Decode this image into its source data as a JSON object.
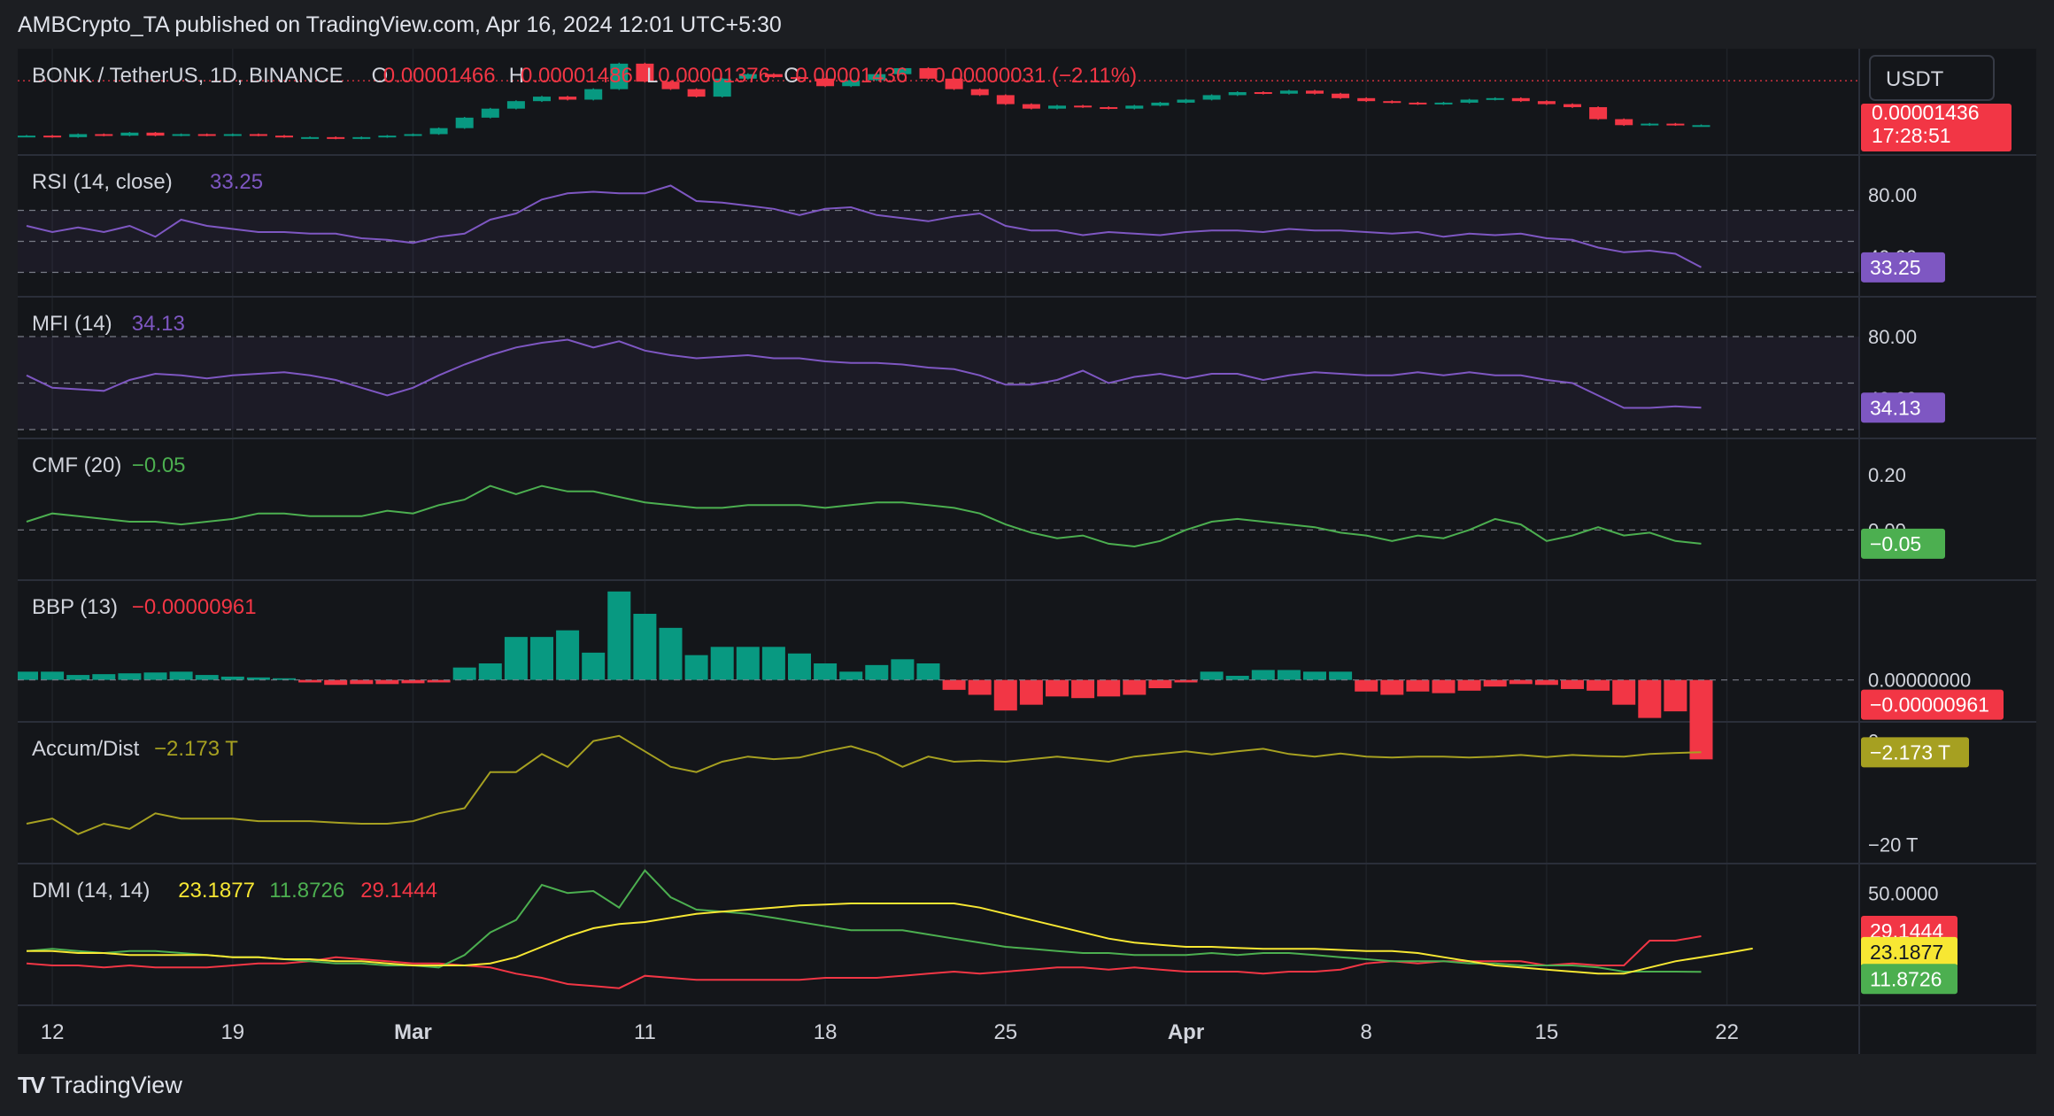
{
  "publisher": "AMBCrypto_TA published on TradingView.com, Apr 16, 2024 12:01 UTC+5:30",
  "footer": {
    "brand": "TradingView"
  },
  "currency_button": "USDT",
  "colors": {
    "up": "#089981",
    "down": "#f23645",
    "purple": "#7e57c2",
    "green": "#4caf50",
    "yellow": "#f7e733",
    "olive": "#a6a021",
    "text": "#d1d4dc"
  },
  "main": {
    "symbol": "BONK / TetherUS, 1D, BINANCE",
    "o_label": "O",
    "o": "0.00001466",
    "h_label": "H",
    "h": "0.00001486",
    "l_label": "L",
    "l": "0.00001376",
    "c_label": "C",
    "c": "0.00001436",
    "change": "−0.00000031 (−2.11%)",
    "price_badge": "0.00001436",
    "countdown": "17:28:51"
  },
  "rsi": {
    "label": "RSI (14, close)",
    "value": "33.25",
    "ticks": [
      "80.00",
      "40.00"
    ]
  },
  "mfi": {
    "label": "MFI (14)",
    "value": "34.13",
    "ticks": [
      "80.00",
      "40.00"
    ]
  },
  "cmf": {
    "label": "CMF (20)",
    "value": "−0.05",
    "ticks": [
      "0.20",
      "0.00"
    ]
  },
  "bbp": {
    "label": "BBP (13)",
    "value": "−0.00000961",
    "ticks": [
      "0.00000000"
    ]
  },
  "ad": {
    "label": "Accum/Dist",
    "value": "−2.173 T",
    "ticks": [
      "0",
      "−20 T"
    ]
  },
  "dmi": {
    "label": "DMI (14, 14)",
    "adx": "23.1877",
    "plus": "11.8726",
    "minus": "29.1444",
    "ticks": [
      "50.0000"
    ]
  },
  "x_axis": [
    "12",
    "19",
    "Mar",
    "11",
    "18",
    "25",
    "Apr",
    "8",
    "15",
    "22"
  ],
  "chart_data": [
    {
      "type": "candlestick",
      "title": "BONK / TetherUS, 1D, BINANCE",
      "x": "daily, 2024-02-11 to 2024-04-16",
      "close": [
        1.07e-05,
        1.06e-05,
        1.08e-05,
        1.07e-05,
        1.09e-05,
        1.07e-05,
        1.08e-05,
        1.07e-05,
        1.08e-05,
        1.07e-05,
        1.06e-05,
        1.06e-05,
        1.05e-05,
        1.06e-05,
        1.07e-05,
        1.08e-05,
        1.12e-05,
        1.19e-05,
        1.25e-05,
        1.3e-05,
        1.33e-05,
        1.31e-05,
        1.38e-05,
        1.55e-05,
        1.43e-05,
        1.38e-05,
        1.33e-05,
        1.45e-05,
        1.48e-05,
        1.46e-05,
        1.45e-05,
        1.4e-05,
        1.44e-05,
        1.48e-05,
        1.52e-05,
        1.45e-05,
        1.38e-05,
        1.34e-05,
        1.28e-05,
        1.25e-05,
        1.27e-05,
        1.26e-05,
        1.25e-05,
        1.27e-05,
        1.29e-05,
        1.31e-05,
        1.34e-05,
        1.36e-05,
        1.35e-05,
        1.37e-05,
        1.35e-05,
        1.32e-05,
        1.3e-05,
        1.29e-05,
        1.28e-05,
        1.29e-05,
        1.31e-05,
        1.32e-05,
        1.3e-05,
        1.28e-05,
        1.26e-05,
        1.18e-05,
        1.14e-05,
        1.15e-05,
        1.14e-05,
        1.14e-05
      ],
      "price_last": 1.436e-05
    },
    {
      "type": "line",
      "name": "RSI (14, close)",
      "ylim": [
        20,
        100
      ],
      "values": [
        60,
        56,
        59,
        56,
        60,
        53,
        64,
        60,
        58,
        56,
        56,
        55,
        55,
        52,
        51,
        49,
        53,
        55,
        64,
        68,
        77,
        81,
        82,
        81,
        81,
        86,
        76,
        75,
        73,
        71,
        67,
        71,
        72,
        67,
        65,
        63,
        66,
        68,
        60,
        57,
        57,
        54,
        56,
        55,
        54,
        56,
        57,
        57,
        56,
        58,
        57,
        57,
        56,
        55,
        56,
        53,
        55,
        54,
        55,
        52,
        51,
        46,
        43,
        44,
        42,
        33.25
      ],
      "hlines": [
        70,
        50,
        30
      ],
      "axis_ticks": [
        80,
        40
      ]
    },
    {
      "type": "line",
      "name": "MFI (14)",
      "ylim": [
        20,
        100
      ],
      "values": [
        55,
        47,
        46,
        45,
        52,
        56,
        55,
        53,
        55,
        56,
        57,
        55,
        52,
        47,
        42,
        47,
        55,
        62,
        68,
        73,
        76,
        78,
        73,
        77,
        71,
        68,
        66,
        67,
        68,
        66,
        66,
        64,
        63,
        63,
        62,
        60,
        59,
        55,
        49,
        49,
        52,
        58,
        50,
        54,
        56,
        53,
        56,
        56,
        52,
        55,
        57,
        56,
        55,
        55,
        57,
        55,
        57,
        55,
        55,
        52,
        50,
        42,
        34,
        34,
        35,
        34.13
      ],
      "hlines": [
        80,
        50,
        20
      ],
      "axis_ticks": [
        80,
        40
      ]
    },
    {
      "type": "line",
      "name": "CMF (20)",
      "ylim": [
        -0.15,
        0.3
      ],
      "values": [
        0.03,
        0.06,
        0.05,
        0.04,
        0.03,
        0.03,
        0.02,
        0.03,
        0.04,
        0.06,
        0.06,
        0.05,
        0.05,
        0.05,
        0.07,
        0.06,
        0.09,
        0.11,
        0.16,
        0.13,
        0.16,
        0.14,
        0.14,
        0.12,
        0.1,
        0.09,
        0.08,
        0.08,
        0.09,
        0.09,
        0.09,
        0.08,
        0.09,
        0.1,
        0.1,
        0.09,
        0.08,
        0.06,
        0.02,
        -0.01,
        -0.03,
        -0.02,
        -0.05,
        -0.06,
        -0.04,
        0.0,
        0.03,
        0.04,
        0.03,
        0.02,
        0.01,
        -0.01,
        -0.02,
        -0.04,
        -0.02,
        -0.03,
        0.0,
        0.04,
        0.02,
        -0.04,
        -0.02,
        0.01,
        -0.02,
        -0.01,
        -0.04,
        -0.05
      ],
      "hlines": [
        0
      ],
      "axis_ticks": [
        0.2,
        0.0
      ]
    },
    {
      "type": "bar",
      "name": "BBP (13)",
      "ylim": [
        -4e-06,
        1.1e-05
      ],
      "values": [
        1e-06,
        1e-06,
        6e-07,
        7e-07,
        8e-07,
        9e-07,
        1e-06,
        6e-07,
        4e-07,
        3e-07,
        2e-07,
        -3e-07,
        -6e-07,
        -5e-07,
        -5e-07,
        -4e-07,
        -3e-07,
        1.5e-06,
        2e-06,
        5.2e-06,
        5.2e-06,
        6e-06,
        3.3e-06,
        1.07e-05,
        8e-06,
        6.3e-06,
        3e-06,
        4e-06,
        4e-06,
        4e-06,
        3.2e-06,
        2e-06,
        1e-06,
        1.8e-06,
        2.5e-06,
        2e-06,
        -1.2e-06,
        -1.8e-06,
        -3.7e-06,
        -3e-06,
        -2e-06,
        -2.2e-06,
        -2e-06,
        -1.8e-06,
        -1e-06,
        -3e-07,
        1e-06,
        5e-07,
        1.2e-06,
        1.2e-06,
        1e-06,
        1e-06,
        -1.4e-06,
        -1.8e-06,
        -1.4e-06,
        -1.6e-06,
        -1.3e-06,
        -8e-07,
        -5e-07,
        -6e-07,
        -1.1e-06,
        -1.3e-06,
        -3e-06,
        -4.6e-06,
        -3.8e-06,
        -9.61e-06
      ]
    },
    {
      "type": "line",
      "name": "Accum/Dist",
      "ylim": [
        -22,
        2
      ],
      "values": [
        -16,
        -15,
        -18,
        -16,
        -17,
        -14,
        -15,
        -15,
        -15,
        -15.5,
        -15.5,
        -15.5,
        -15.8,
        -16,
        -16,
        -15.5,
        -14,
        -13,
        -6,
        -6,
        -2.5,
        -5,
        0,
        1,
        -2,
        -5,
        -6,
        -4,
        -3,
        -3.5,
        -3.2,
        -2,
        -1,
        -2.5,
        -5,
        -3,
        -4,
        -3.8,
        -4,
        -3.5,
        -3,
        -3.5,
        -4,
        -3,
        -2.5,
        -2,
        -2.6,
        -2,
        -1.5,
        -2.5,
        -3,
        -2.4,
        -3,
        -3.2,
        -3,
        -3,
        -3.2,
        -3,
        -2.7,
        -3.1,
        -2.7,
        -2.9,
        -3,
        -2.5,
        -2.3,
        -2.173
      ]
    },
    {
      "type": "line",
      "name": "DMI (14, 14)",
      "ylim": [
        0,
        60
      ],
      "series": [
        {
          "name": "ADX",
          "values": [
            22,
            22,
            21,
            21,
            20,
            20,
            20,
            20,
            19,
            19,
            18,
            18,
            17,
            17,
            16,
            15,
            15,
            15,
            16,
            19,
            24,
            29,
            33,
            35,
            36,
            38,
            40,
            41,
            42,
            43,
            44,
            44.5,
            45,
            45,
            45,
            45,
            45,
            43,
            40,
            37,
            34,
            31,
            28,
            26,
            25,
            24,
            24,
            23.5,
            23,
            23,
            23,
            22.5,
            22,
            22,
            21,
            19,
            17,
            15,
            14,
            13,
            12,
            11,
            11,
            14,
            17,
            19,
            21,
            23.1877
          ]
        },
        {
          "name": "+DI",
          "values": [
            22,
            23,
            22,
            21,
            22,
            22,
            21,
            20,
            19,
            19,
            18,
            17,
            16,
            16,
            15,
            15,
            14,
            20,
            31,
            37,
            54,
            50,
            51,
            43,
            61,
            48,
            42,
            41,
            40,
            38,
            36,
            34,
            32,
            32,
            32,
            30,
            28,
            26,
            24,
            23,
            22,
            21,
            21,
            20,
            20,
            20,
            21,
            20,
            21,
            21,
            20,
            19,
            18,
            17,
            17,
            17,
            16,
            16,
            15,
            15,
            15,
            14,
            12,
            12,
            12,
            11.8726
          ]
        },
        {
          "name": "−DI",
          "values": [
            16,
            15,
            15,
            14,
            15,
            14,
            14,
            14,
            15,
            16,
            16,
            17,
            19,
            18,
            17,
            16,
            16,
            15,
            14,
            11,
            9,
            6,
            5,
            4,
            10,
            9,
            8,
            8,
            8,
            8,
            8,
            9,
            9,
            9,
            10,
            11,
            12,
            11,
            12,
            13,
            14,
            14,
            13,
            14,
            13,
            12,
            12,
            12,
            11,
            12,
            12,
            13,
            16,
            17,
            16,
            17,
            17,
            17,
            17,
            15,
            16,
            15,
            15,
            27,
            27,
            29.1444
          ]
        }
      ],
      "axis_ticks": [
        50
      ]
    }
  ]
}
